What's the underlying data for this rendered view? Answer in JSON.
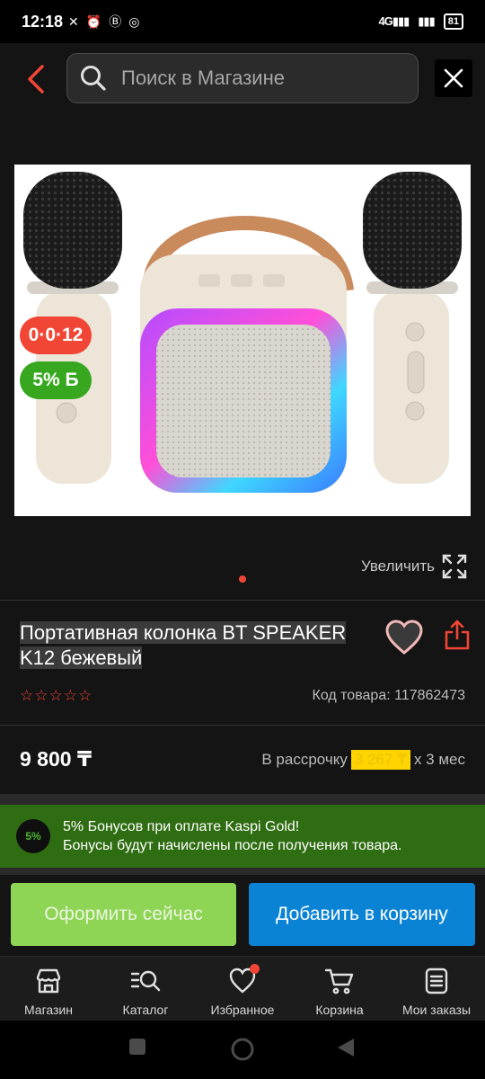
{
  "status_bar": {
    "time": "12:18",
    "network": "4G",
    "battery": "81"
  },
  "header": {
    "search_placeholder": "Поиск в Магазине"
  },
  "product": {
    "badge_installment": "0·0·12",
    "badge_bonus": "5% Б",
    "zoom_label": "Увеличить",
    "title": "Портативная колонка BT SPEAKER K12 бежевый",
    "rating_stars": "☆☆☆☆☆",
    "sku": "Код товара: 117862473",
    "price": "9 800 ₸",
    "installment_prefix": "В рассрочку",
    "installment_amount": "3 267 ₸",
    "installment_suffix": "х 3 мес"
  },
  "bonus_banner": {
    "circle": "5%",
    "line1": "5% Бонусов при оплате Kaspi Gold!",
    "line2": "Бонусы будут начислены после получения товара."
  },
  "actions": {
    "checkout": "Оформить сейчас",
    "add_to_cart": "Добавить в корзину"
  },
  "bottom_nav": [
    {
      "label": "Магазин",
      "icon": "store-icon"
    },
    {
      "label": "Каталог",
      "icon": "catalog-search-icon"
    },
    {
      "label": "Избранное",
      "icon": "heart-icon"
    },
    {
      "label": "Корзина",
      "icon": "cart-icon"
    },
    {
      "label": "Мои заказы",
      "icon": "orders-icon"
    }
  ],
  "colors": {
    "accent": "#f14635",
    "green": "#36a71f",
    "blue": "#0b83d4",
    "yellow": "#ffd400"
  }
}
